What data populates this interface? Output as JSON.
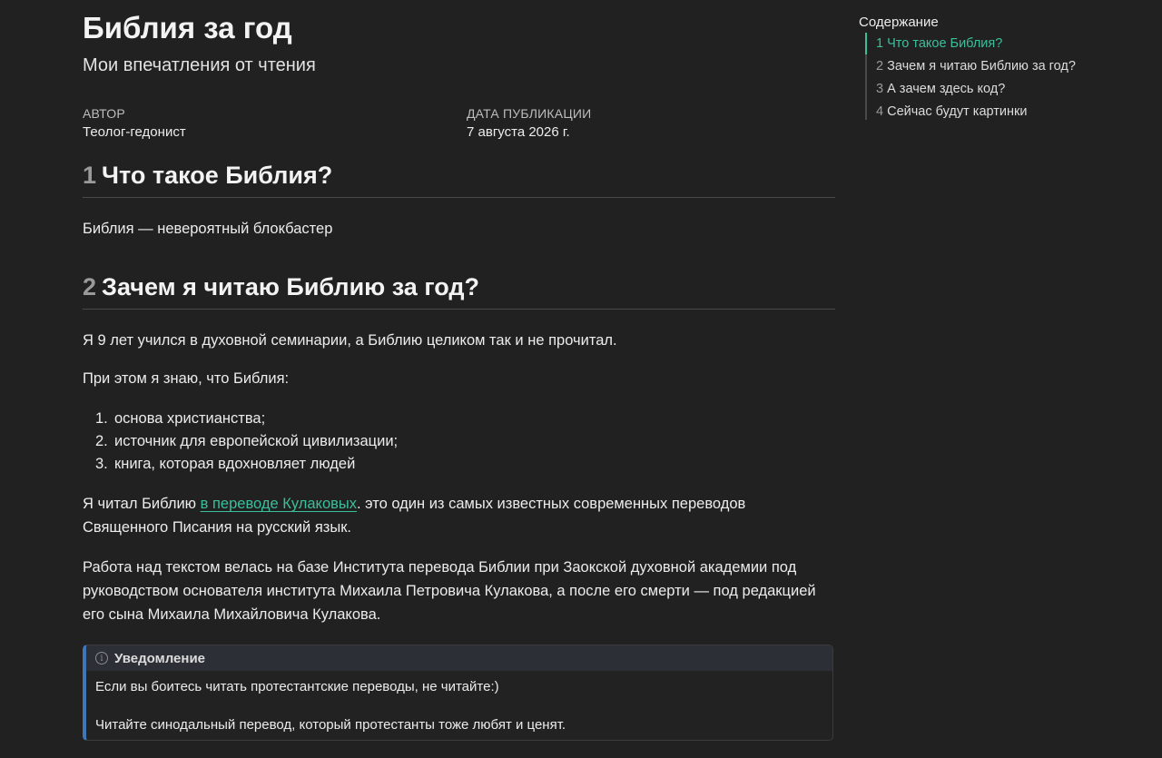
{
  "header": {
    "title": "Библия за год",
    "subtitle": "Мои впечатления от чтения",
    "author_label": "АВТОР",
    "author_value": "Теолог-гедонист",
    "date_label": "ДАТА ПУБЛИКАЦИИ",
    "date_value": "7 августа 2026 г."
  },
  "section1": {
    "number": "1",
    "title": "Что такое Библия?",
    "text": "Библия — невероятный блокбастер"
  },
  "section2": {
    "number": "2",
    "title": "Зачем я читаю Библию за год?",
    "p1": "Я 9 лет учился в духовной семинарии, а Библию целиком так и не прочитал.",
    "p2": "При этом я знаю, что Библия:",
    "list": [
      {
        "num": "1.",
        "text": "основа христианства;"
      },
      {
        "num": "2.",
        "text": "источник для европейской цивилизации;"
      },
      {
        "num": "3.",
        "text": "книга, которая вдохновляет людей"
      }
    ],
    "p3_before": "Я читал Библию ",
    "p3_link": "в переводе Кулаковых",
    "p3_after": ". это один из самых известных современных переводов Священного Писания на русский язык.",
    "p4": "Работа над текстом велась на базе Института перевода Библии при Заокской духовной академии под руководством основателя института Михаила Петровича Кулакова, а после его смерти — под редакцией его сына Михаила Михайловича Кулакова."
  },
  "callout": {
    "icon": "info-icon",
    "title": "Уведомление",
    "line1": "Если вы боитесь читать протестантские переводы, не читайте:)",
    "line2": "Читайте синодальный перевод, который протестанты тоже любят и ценят."
  },
  "toc": {
    "title": "Содержание",
    "items": [
      {
        "num": "1",
        "label": "Что такое Библия?",
        "active": true
      },
      {
        "num": "2",
        "label": "Зачем я читаю Библию за год?",
        "active": false
      },
      {
        "num": "3",
        "label": "А зачем здесь код?",
        "active": false
      },
      {
        "num": "4",
        "label": "Сейчас будут картинки",
        "active": false
      }
    ]
  },
  "colors": {
    "background": "#212121",
    "accent": "#3bbf9a",
    "callout_border": "#3f76b8"
  }
}
